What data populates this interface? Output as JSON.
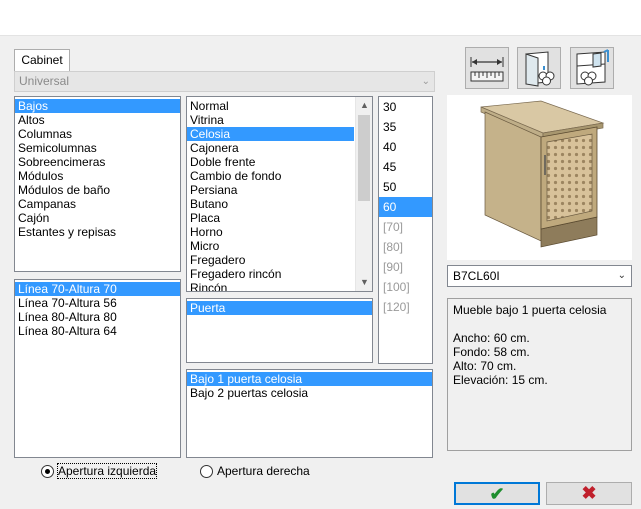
{
  "tab": {
    "label": "Cabinet"
  },
  "style_combo": {
    "value": "Universal"
  },
  "categories": {
    "items": [
      "Bajos",
      "Altos",
      "Columnas",
      "Semicolumnas",
      "Sobreencimeras",
      "Módulos",
      "Módulos de baño",
      "Campanas",
      "Cajón",
      "Estantes y repisas"
    ],
    "selected_index": 0
  },
  "types": {
    "items": [
      "Normal",
      "Vitrina",
      "Celosia",
      "Cajonera",
      "Doble frente",
      "Cambio de fondo",
      "Persiana",
      "Butano",
      "Placa",
      "Horno",
      "Micro",
      "Fregadero",
      "Fregadero rincón",
      "Rincón"
    ],
    "selected_index": 2
  },
  "sizes": {
    "items": [
      {
        "label": "30",
        "enabled": true
      },
      {
        "label": "35",
        "enabled": true
      },
      {
        "label": "40",
        "enabled": true
      },
      {
        "label": "45",
        "enabled": true
      },
      {
        "label": "50",
        "enabled": true
      },
      {
        "label": "60",
        "enabled": true
      },
      {
        "label": "[70]",
        "enabled": false
      },
      {
        "label": "[80]",
        "enabled": false
      },
      {
        "label": "[90]",
        "enabled": false
      },
      {
        "label": "[100]",
        "enabled": false
      },
      {
        "label": "[120]",
        "enabled": false
      }
    ],
    "selected_index": 5
  },
  "lines": {
    "items": [
      "Línea 70-Altura 70",
      "Línea 70-Altura 56",
      "Línea 80-Altura 80",
      "Línea 80-Altura 64"
    ],
    "selected_index": 0
  },
  "door": {
    "items": [
      "Puerta"
    ],
    "selected_index": 0
  },
  "models": {
    "items": [
      "Bajo 1 puerta celosia",
      "Bajo 2 puertas celosia"
    ],
    "selected_index": 0
  },
  "opening": {
    "left_label": "Apertura izquierda",
    "right_label": "Apertura derecha",
    "selected": "left"
  },
  "tools": [
    "dimension-icon",
    "cabinet-door-icon",
    "cabinet-shelf-icon"
  ],
  "code_combo": {
    "value": "B7CL60I"
  },
  "info": {
    "lines": [
      "Mueble bajo 1 puerta celosia",
      "",
      "Ancho: 60 cm.",
      "Fondo: 58 cm.",
      "Alto: 70 cm.",
      "Elevación: 15 cm."
    ]
  },
  "buttons": {
    "ok_symbol": "✔",
    "cancel_symbol": "✖"
  },
  "colors": {
    "selection": "#3399ff",
    "focus_border": "#0078d7",
    "ok": "#1e8e2e",
    "cancel": "#c0202c"
  }
}
